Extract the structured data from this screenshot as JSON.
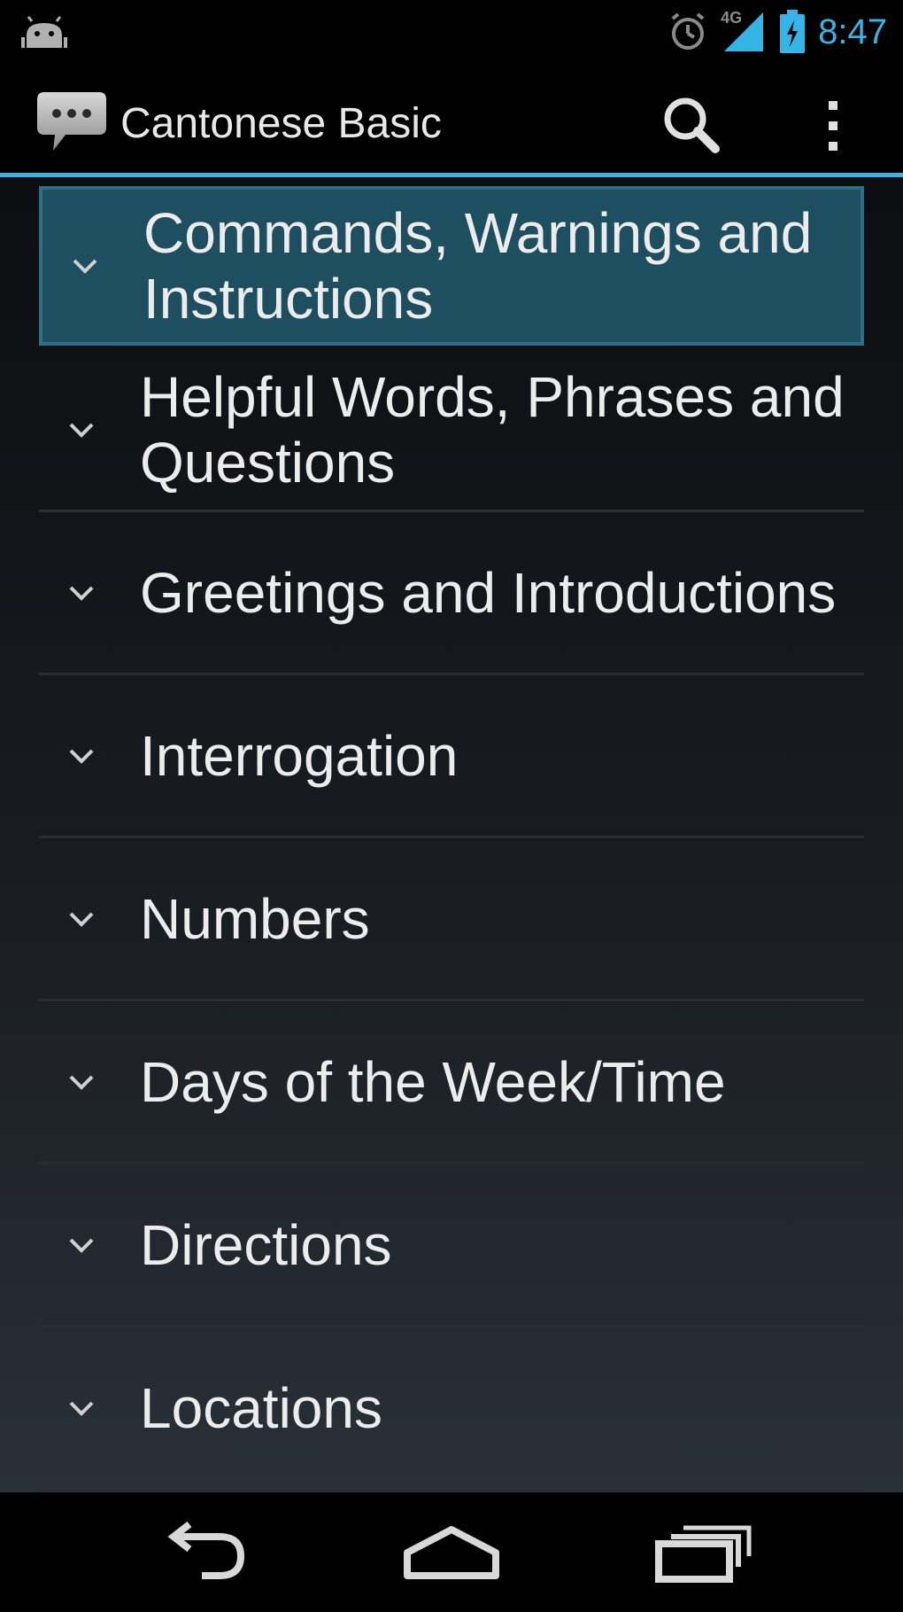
{
  "status_bar": {
    "time": "8:47",
    "network_label": "4G",
    "icons": [
      "android-icon",
      "alarm-icon",
      "signal-icon",
      "battery-icon"
    ]
  },
  "action_bar": {
    "title": "Cantonese Basic",
    "app_icon": "speech-bubble-icon",
    "actions": [
      "search-icon",
      "overflow-menu-icon"
    ]
  },
  "list": {
    "items": [
      {
        "label": "Commands, Warnings and Instructions",
        "selected": true
      },
      {
        "label": "Helpful Words, Phrases and Questions",
        "selected": false
      },
      {
        "label": "Greetings and Introductions",
        "selected": false
      },
      {
        "label": "Interrogation",
        "selected": false
      },
      {
        "label": "Numbers",
        "selected": false
      },
      {
        "label": "Days of the Week/Time",
        "selected": false
      },
      {
        "label": "Directions",
        "selected": false
      },
      {
        "label": "Locations",
        "selected": false
      }
    ]
  },
  "nav_bar": {
    "buttons": [
      "back-icon",
      "home-icon",
      "recent-apps-icon"
    ]
  },
  "colors": {
    "accent": "#33b5e5",
    "selected_row": "#1d4f61",
    "text": "#ececec",
    "background": "#000000"
  }
}
